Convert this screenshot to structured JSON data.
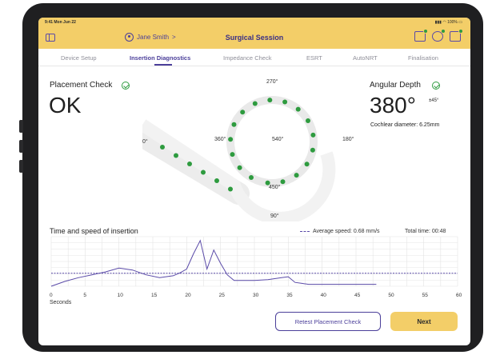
{
  "status": {
    "time_date": "9:41  Mon Jun 22",
    "battery": "100%"
  },
  "navbar": {
    "user_name": "Jane Smith",
    "chevron": ">",
    "title": "Surgical Session"
  },
  "tabs": [
    {
      "label": "Device Setup"
    },
    {
      "label": "Insertion Diagnostics"
    },
    {
      "label": "Impedance Check"
    },
    {
      "label": "ESRT"
    },
    {
      "label": "AutoNRT"
    },
    {
      "label": "Finalisation"
    }
  ],
  "placement": {
    "title": "Placement Check",
    "value": "OK"
  },
  "angular": {
    "title": "Angular Depth",
    "value": "380°",
    "sup": "±45°",
    "diameter": "Cochlear diameter: 6.25mm"
  },
  "spiral": {
    "labels": [
      "270°",
      "0°",
      "360°",
      "540°",
      "180°",
      "450°",
      "90°"
    ],
    "status_color": "#2e9b3f"
  },
  "chart_data": {
    "type": "line",
    "title": "Time and speed of insertion",
    "xlabel": "Seconds",
    "ylabel": "",
    "xlim": [
      0,
      60
    ],
    "x_ticks": [
      "0",
      "5",
      "10",
      "15",
      "20",
      "25",
      "30",
      "35",
      "40",
      "45",
      "50",
      "55",
      "60"
    ],
    "average_speed_label": "Average speed: 0.68 mm/s",
    "total_time_label": "Total time: 00:48",
    "grid": true,
    "average_line": 0.68,
    "speed_series": {
      "x": [
        0,
        2,
        4,
        6,
        8,
        10,
        12,
        14,
        16,
        18,
        19,
        20,
        21,
        22,
        23,
        24,
        25,
        26,
        27,
        28,
        30,
        32,
        34,
        35,
        36,
        37,
        38,
        40,
        42,
        45,
        48
      ],
      "y": [
        0.0,
        0.25,
        0.45,
        0.6,
        0.75,
        0.95,
        0.85,
        0.6,
        0.45,
        0.55,
        0.7,
        0.9,
        1.7,
        2.4,
        0.9,
        1.9,
        1.2,
        0.6,
        0.3,
        0.3,
        0.3,
        0.35,
        0.45,
        0.5,
        0.2,
        0.15,
        0.1,
        0.1,
        0.1,
        0.1,
        0.1
      ]
    }
  },
  "buttons": {
    "retest": "Retest Placement Check",
    "next": "Next"
  }
}
